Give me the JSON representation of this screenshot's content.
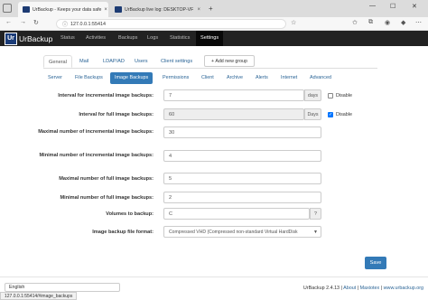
{
  "browser": {
    "tabs": [
      {
        "label": "UrBackup - Keeps your data safe"
      },
      {
        "label": "UrBackup live log: DESKTOP-VF"
      }
    ],
    "tab_close": "×",
    "new_tab": "+",
    "url": "127.0.0.1:55414",
    "window_controls": {
      "minimize": "—",
      "maximize": "☐",
      "close": "✕"
    }
  },
  "app": {
    "logo_text": "UrBackup",
    "nav": [
      "Status",
      "Activities",
      "Backups",
      "Logs",
      "Statistics",
      "Settings"
    ],
    "active_nav": "Settings"
  },
  "settings_tabs": [
    "General",
    "Mail",
    "LDAP/AD",
    "Users",
    "Client settings"
  ],
  "add_group_label": "+ Add new group",
  "general_subtabs": [
    "Server",
    "File Backups",
    "Image Backups",
    "Permissions",
    "Client",
    "Archive",
    "Alerts",
    "Internet",
    "Advanced"
  ],
  "form": {
    "incr_interval": {
      "label": "Interval for incremental image backups:",
      "value": "7",
      "unit": "days",
      "disable_label": "Disable",
      "disabled": false
    },
    "full_interval": {
      "label": "Interval for full image backups:",
      "value": "60",
      "unit": "Days",
      "disable_label": "Disable",
      "disabled": true
    },
    "max_incr": {
      "label": "Maximal number of incremental image backups:",
      "value": "30"
    },
    "min_incr": {
      "label": "Minimal number of incremental image backups:",
      "value": "4"
    },
    "max_full": {
      "label": "Maximal number of full image backups:",
      "value": "5"
    },
    "min_full": {
      "label": "Minimal number of full image backups:",
      "value": "2"
    },
    "volumes": {
      "label": "Volumes to backup:",
      "value": "C",
      "help": "?"
    },
    "format": {
      "label": "Image backup file format:",
      "value": "Compressed VHD (Compressed non-standard Virtual HardDisk"
    }
  },
  "save_label": "Save",
  "language": "English",
  "footer": {
    "version": "UrBackup 2.4.13 |",
    "about": "About",
    "sep": "|",
    "maxiotex": "Maxiotex",
    "sep2": "|",
    "site": "www.urbackup.org"
  },
  "status_bar": "127.0.0.1:55414/#image_backups"
}
